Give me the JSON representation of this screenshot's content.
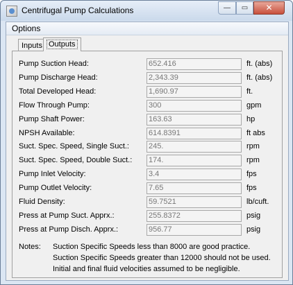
{
  "window": {
    "title": "Centrifugal Pump Calculations",
    "minimize_glyph": "—",
    "maximize_glyph": "▭",
    "close_glyph": "✕"
  },
  "menu": {
    "options_label": "Options"
  },
  "tabs": [
    {
      "label": "Inputs",
      "selected": false
    },
    {
      "label": "Outputs",
      "selected": true
    }
  ],
  "outputs": [
    {
      "label": "Pump Suction Head:",
      "value": "652.416",
      "unit": "ft. (abs)"
    },
    {
      "label": "Pump Discharge Head:",
      "value": "2,343.39",
      "unit": "ft. (abs)"
    },
    {
      "label": "Total Developed Head:",
      "value": "1,690.97",
      "unit": "ft."
    },
    {
      "label": "Flow Through Pump:",
      "value": "300",
      "unit": "gpm"
    },
    {
      "label": "Pump Shaft Power:",
      "value": "163.63",
      "unit": "hp"
    },
    {
      "label": "NPSH Available:",
      "value": "614.8391",
      "unit": "ft abs"
    },
    {
      "label": "Suct. Spec. Speed, Single Suct.:",
      "value": "245.",
      "unit": "rpm"
    },
    {
      "label": "Suct. Spec. Speed, Double Suct.:",
      "value": "174.",
      "unit": "rpm"
    },
    {
      "label": "Pump Inlet Velocity:",
      "value": "3.4",
      "unit": "fps"
    },
    {
      "label": "Pump Outlet Velocity:",
      "value": "7.65",
      "unit": "fps"
    },
    {
      "label": "Fluid Density:",
      "value": "59.7521",
      "unit": "lb/cuft."
    },
    {
      "label": "Press at Pump Suct. Apprx.:",
      "value": "255.8372",
      "unit": "psig"
    },
    {
      "label": "Press at Pump Disch. Apprx.:",
      "value": "956.77",
      "unit": "psig"
    }
  ],
  "notes": {
    "label": "Notes:",
    "lines": [
      "Suction Specific Speeds less than 8000 are good practice.",
      "Suction Specific Speeds greater than 12000 should not be used.",
      "Initial and final fluid velocities assumed to be negligible."
    ]
  }
}
